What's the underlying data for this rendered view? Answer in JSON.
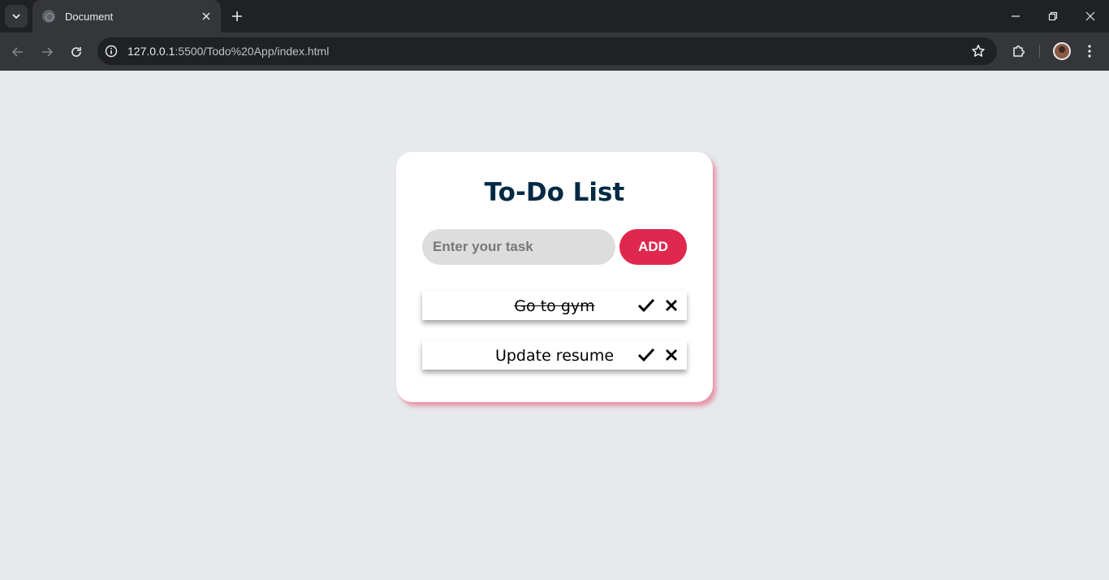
{
  "browser": {
    "tab_title": "Document",
    "url_host": "127.0.0.1",
    "url_path": ":5500/Todo%20App/index.html",
    "icons": {
      "tab_search": "chevron-down-icon",
      "tab_close": "close-icon",
      "new_tab": "plus-icon",
      "back": "arrow-left-icon",
      "forward": "arrow-right-icon",
      "reload": "reload-icon",
      "site_info": "info-icon",
      "bookmark": "star-icon",
      "extensions": "puzzle-icon",
      "profile": "avatar",
      "menu": "more-vert-icon"
    }
  },
  "app": {
    "title": "To-Do List",
    "input_placeholder": "Enter your task",
    "add_label": "ADD",
    "accent_color": "#e0284e",
    "title_color": "#002944",
    "tasks": [
      {
        "text": "Go to gym",
        "done": true
      },
      {
        "text": "Update resume",
        "done": false
      }
    ]
  }
}
